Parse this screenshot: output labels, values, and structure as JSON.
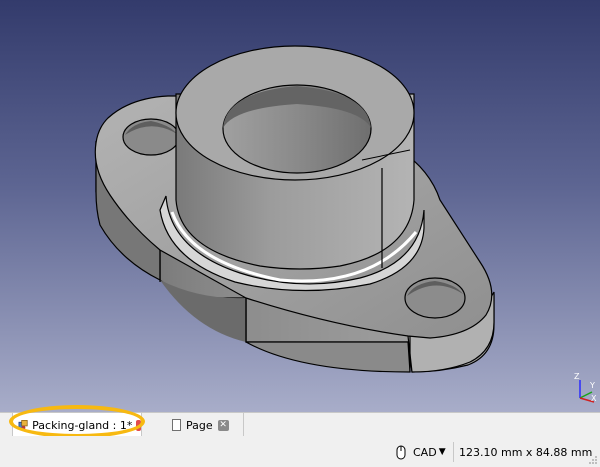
{
  "document_tabs": [
    {
      "label": "Packing-gland : 1*",
      "active": true,
      "icon": "part-document-icon"
    },
    {
      "label": "Page",
      "active": false,
      "icon": "page-document-icon"
    }
  ],
  "statusbar": {
    "navigation_style": "CAD",
    "dimensions": "123.10 mm x 84.88 mm"
  },
  "axis_labels": {
    "z": "Z",
    "y": "Y",
    "x": "X"
  },
  "colors": {
    "viewport_top": "#333b6c",
    "viewport_bottom": "#a8adc9",
    "model_gray": "#9a9a9a",
    "highlight": "#f7b911"
  }
}
